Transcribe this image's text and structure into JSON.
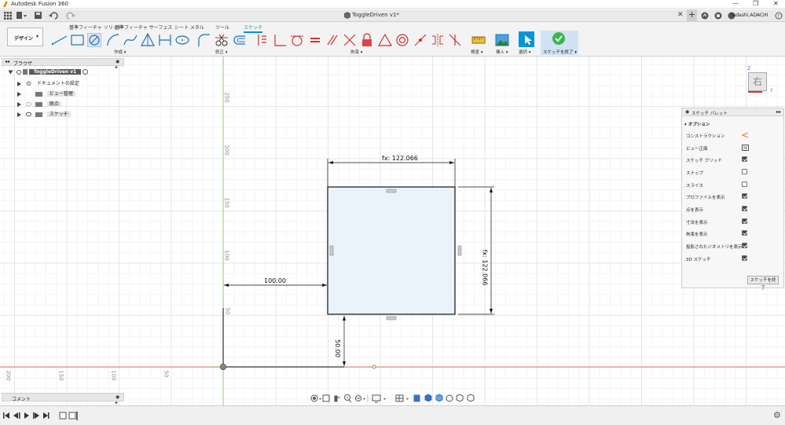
{
  "app": {
    "title": "Autodesk Fusion 360"
  },
  "tabbar": {
    "document_tab": "ToggleDriven v1*",
    "user": "Tadashi.ADACHI"
  },
  "ribbon": {
    "workspace": "デザイン",
    "tabs": [
      "基準フィーチャ ソリッド",
      "基準フィーチャ サーフェス",
      "シート メタル",
      "ツール",
      "スケッチ"
    ],
    "groups": {
      "create": "作成",
      "modify": "修正",
      "constraints": "拘束",
      "inspect": "検査",
      "insert": "挿入",
      "select": "選択",
      "finish": "スケッチを終了"
    }
  },
  "browser": {
    "header": "ブラウザ",
    "root": "ToggleDriven v1",
    "items": [
      "ドキュメントの設定",
      "ビュー管理",
      "原点",
      "スケッチ"
    ]
  },
  "viewcube": {
    "face_label": "右",
    "axis_z": "Z",
    "axis_y": "Y"
  },
  "canvas": {
    "v_axis_labels": [
      "250",
      "200",
      "150",
      "100",
      "50"
    ],
    "h_axis_labels": [
      "200",
      "150",
      "100",
      "50"
    ],
    "dim_top": "fx: 122.066",
    "dim_right": "fx: 122.066",
    "dim_left": "100.00",
    "dim_bottom": "50.00"
  },
  "palette": {
    "title": "スケッチ パレット",
    "section": "オプション",
    "rows": [
      {
        "label": "コンストラクション",
        "type": "icon"
      },
      {
        "label": "ビュー正面",
        "type": "icon"
      },
      {
        "label": "スケッチ グリッド",
        "checked": true
      },
      {
        "label": "スナップ",
        "checked": false
      },
      {
        "label": "スライス",
        "checked": false
      },
      {
        "label": "プロファイルを表示",
        "checked": true
      },
      {
        "label": "点を表示",
        "checked": true
      },
      {
        "label": "寸法を表示",
        "checked": true
      },
      {
        "label": "拘束を表示",
        "checked": true
      },
      {
        "label": "投影されたジオメトリを表示",
        "checked": true
      },
      {
        "label": "3D スケッチ",
        "checked": true
      }
    ],
    "finish_button": "スケッチを終了"
  },
  "comment": {
    "label": "コメント"
  },
  "colors": {
    "accent": "#0696d7",
    "finish_green": "#3cb54a",
    "sketch_fill": "#eaf3fb",
    "x_axis": "#d9836e",
    "y_axis": "#9fd38e"
  }
}
